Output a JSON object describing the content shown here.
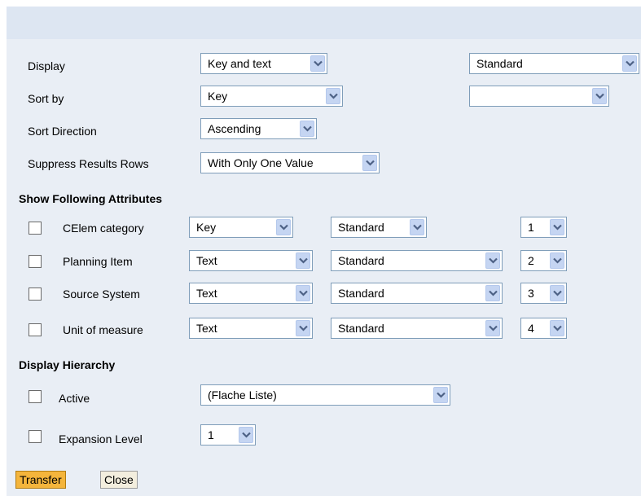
{
  "settings": {
    "display": {
      "label": "Display",
      "value": "Key and text",
      "secondary_value": "Standard"
    },
    "sort_by": {
      "label": "Sort by",
      "value": "Key",
      "secondary_value": ""
    },
    "sort_direction": {
      "label": "Sort Direction",
      "value": "Ascending"
    },
    "suppress_results_rows": {
      "label": "Suppress Results Rows",
      "value": "With Only One Value"
    }
  },
  "attributes": {
    "heading": "Show Following Attributes",
    "rows": [
      {
        "name": "CElem category",
        "display": "Key",
        "sort": "Standard",
        "position": "1"
      },
      {
        "name": "Planning Item",
        "display": "Text",
        "sort": "Standard",
        "position": "2"
      },
      {
        "name": "Source System",
        "display": "Text",
        "sort": "Standard",
        "position": "3"
      },
      {
        "name": "Unit of measure",
        "display": "Text",
        "sort": "Standard",
        "position": "4"
      }
    ]
  },
  "hierarchy": {
    "heading": "Display Hierarchy",
    "active": {
      "label": "Active",
      "value": "(Flache Liste)"
    },
    "expansion_level": {
      "label": "Expansion Level",
      "value": "1"
    }
  },
  "buttons": {
    "transfer": "Transfer",
    "close": "Close"
  },
  "icons": {
    "dropdown": "chevron-down-icon"
  },
  "colors": {
    "panel": "#e9eef5",
    "header_bar": "#dde6f2",
    "primary_button": "#f4b53c",
    "dropdown_arrow": "#c5d5f2"
  }
}
